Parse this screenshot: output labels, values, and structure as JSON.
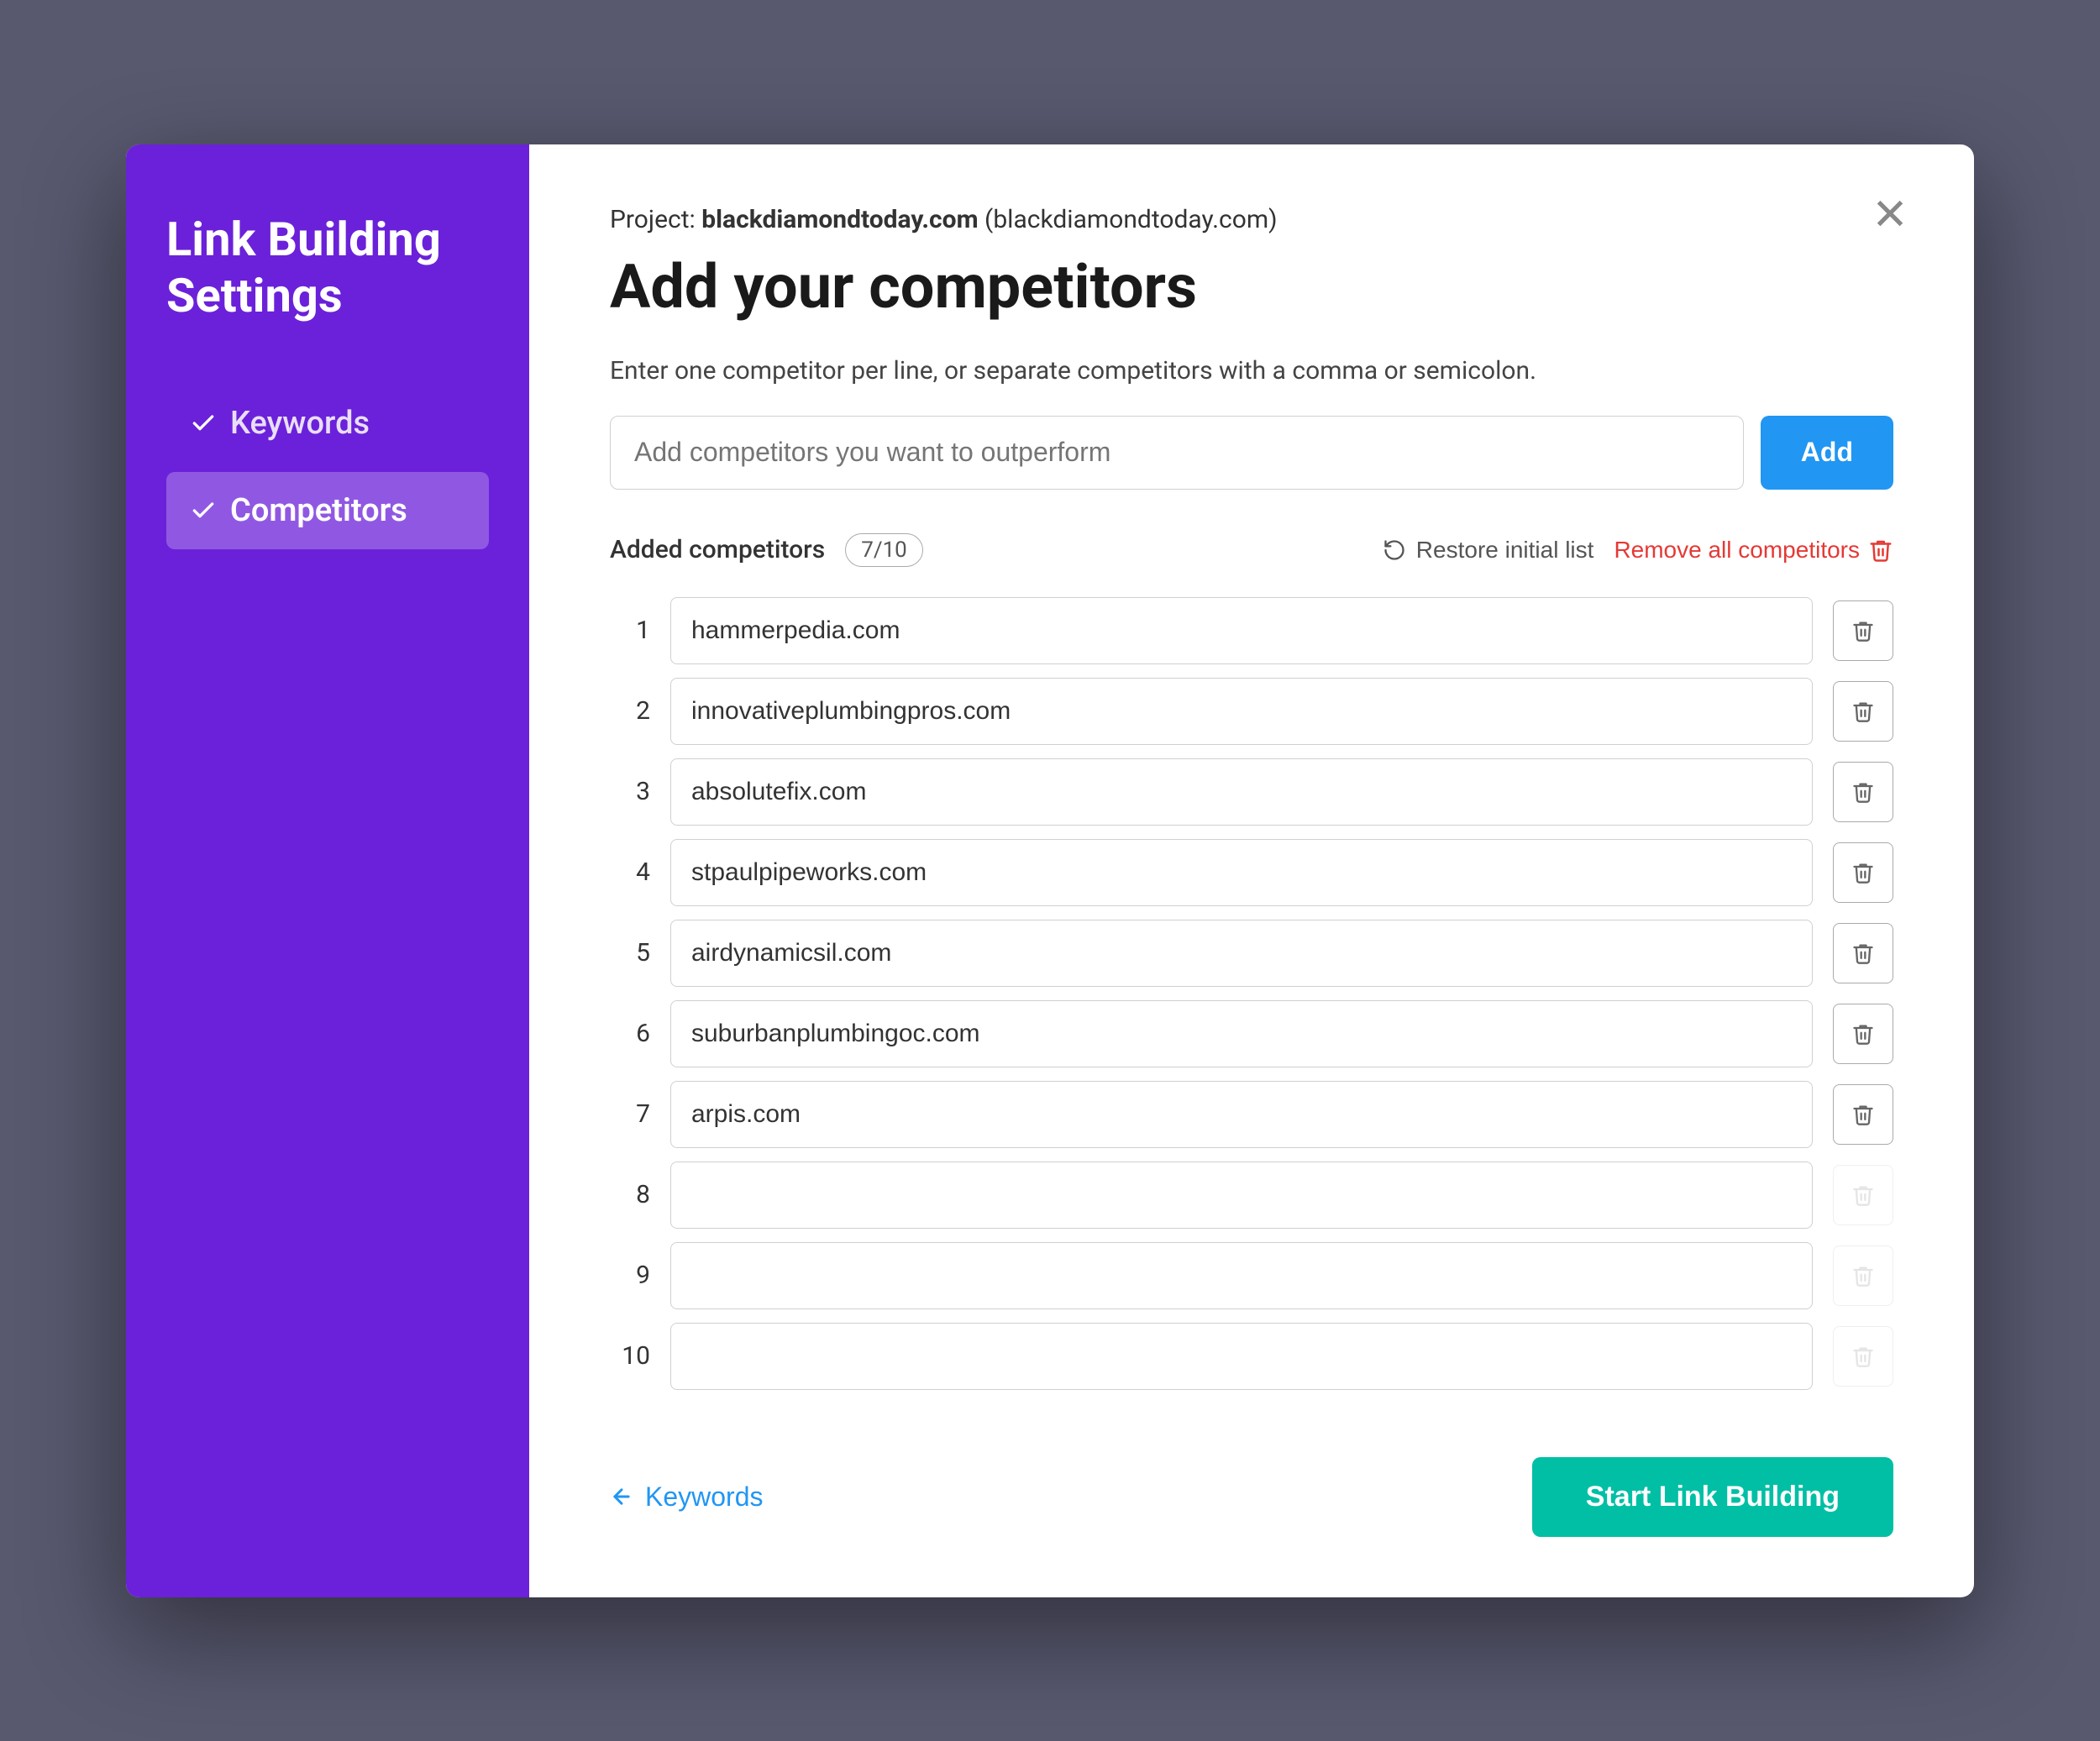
{
  "sidebar": {
    "title": "Link Building\nSettings",
    "nav": [
      {
        "id": "keywords",
        "label": "Keywords",
        "active": false
      },
      {
        "id": "competitors",
        "label": "Competitors",
        "active": true
      }
    ]
  },
  "modal": {
    "project_label": "Project:",
    "project_name": "blackdiamondtoday.com",
    "project_domain": "(blackdiamondtoday.com)",
    "page_title": "Add your competitors",
    "instructions": "Enter one competitor per line, or separate competitors with a comma or semicolon.",
    "input_placeholder": "Add competitors you want to outperform",
    "add_button_label": "Add",
    "competitors_label": "Added competitors",
    "count_badge": "7/10",
    "restore_label": "Restore initial list",
    "remove_all_label": "Remove all competitors",
    "competitors": [
      {
        "index": 1,
        "value": "hammerpedia.com",
        "empty": false
      },
      {
        "index": 2,
        "value": "innovativeplumbingpros.com",
        "empty": false
      },
      {
        "index": 3,
        "value": "absolutefix.com",
        "empty": false
      },
      {
        "index": 4,
        "value": "stpaulpipeworks.com",
        "empty": false
      },
      {
        "index": 5,
        "value": "airdynamicsil.com",
        "empty": false
      },
      {
        "index": 6,
        "value": "suburbanplumbingoc.com",
        "empty": false
      },
      {
        "index": 7,
        "value": "arpis.com",
        "empty": false
      },
      {
        "index": 8,
        "value": "",
        "empty": true
      },
      {
        "index": 9,
        "value": "",
        "empty": true
      },
      {
        "index": 10,
        "value": "",
        "empty": true
      }
    ],
    "back_button_label": "Keywords",
    "start_button_label": "Start Link Building"
  }
}
